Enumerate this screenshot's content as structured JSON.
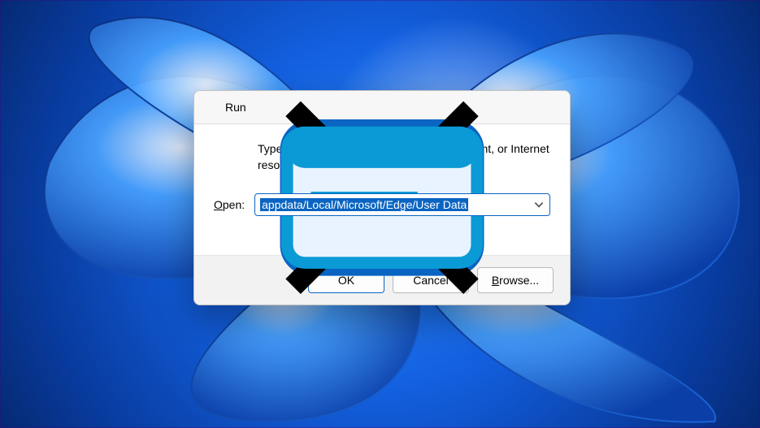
{
  "window": {
    "title": "Run",
    "instruction": "Type the name of a program, folder, document, or Internet resource, and Windows will open it for you."
  },
  "open": {
    "label_pre": "O",
    "label_post": "pen:",
    "value": "appdata/Local/Microsoft/Edge/User Data"
  },
  "buttons": {
    "ok": "OK",
    "cancel": "Cancel",
    "browse_pre": "B",
    "browse_post": "rowse..."
  },
  "icons": {
    "run": "run-icon",
    "close": "close-icon",
    "chevron": "chevron-down-icon"
  }
}
